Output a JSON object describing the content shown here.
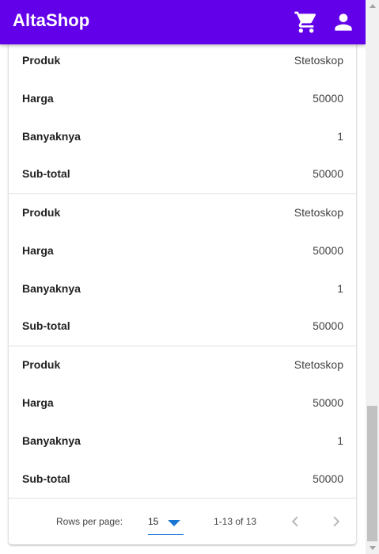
{
  "app": {
    "title": "AltaShop"
  },
  "header": {
    "cart_icon": "cart-icon",
    "user_icon": "account-icon"
  },
  "labels": {
    "product": "Produk",
    "price": "Harga",
    "quantity": "Banyaknya",
    "subtotal": "Sub-total"
  },
  "items": [
    {
      "product": "Stetoskop",
      "price": "50000",
      "quantity": "1",
      "subtotal": "50000"
    },
    {
      "product": "Stetoskop",
      "price": "50000",
      "quantity": "1",
      "subtotal": "50000"
    },
    {
      "product": "Stetoskop",
      "price": "50000",
      "quantity": "1",
      "subtotal": "50000"
    }
  ],
  "pagination": {
    "rows_per_page_label": "Rows per page:",
    "rows_per_page_value": "15",
    "range_text": "1-13 of 13"
  },
  "colors": {
    "primary": "#6200ea",
    "accent": "#1976d2"
  }
}
